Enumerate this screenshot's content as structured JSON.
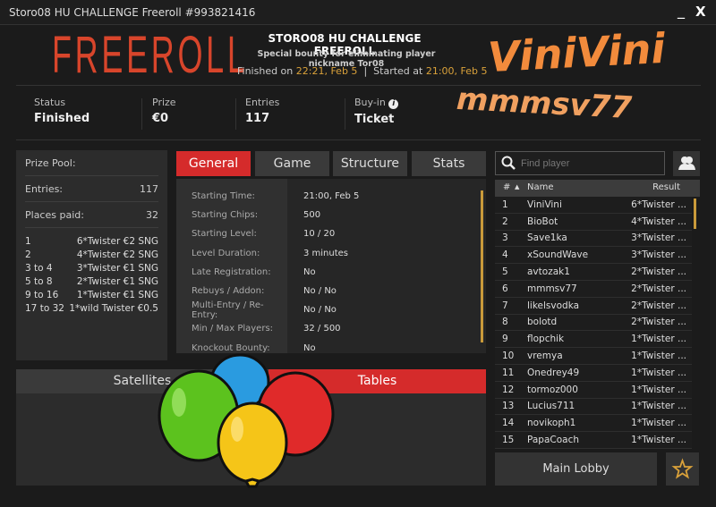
{
  "window": {
    "title": "Storo08 HU CHALLENGE Freeroll #993821416",
    "minimize": "_",
    "close": "X"
  },
  "header": {
    "logo_text": "FREEROLL",
    "title": "STORO08 HU CHALLENGE FREEROLL",
    "subtitle": "Special bounty for eliminating player nickname Tor08",
    "finished_label": "Finished on",
    "finished_time": "22:21, Feb 5",
    "separator": "|",
    "started_label": "Started at",
    "started_time": "21:00, Feb 5"
  },
  "overlay": {
    "text1": "ViniVini",
    "text2": "mmmsv77"
  },
  "stats": [
    {
      "label": "Status",
      "value": "Finished"
    },
    {
      "label": "Prize",
      "value": "€0"
    },
    {
      "label": "Entries",
      "value": "117"
    },
    {
      "label": "Buy-in",
      "value": "Ticket"
    }
  ],
  "prize_pool": {
    "label": "Prize Pool:",
    "entries_label": "Entries:",
    "entries": "117",
    "places_label": "Places paid:",
    "places": "32",
    "payouts": [
      {
        "place": "1",
        "prize": "6*Twister €2 SNG"
      },
      {
        "place": "2",
        "prize": "4*Twister €2 SNG"
      },
      {
        "place": "3  to  4",
        "prize": "3*Twister €1 SNG"
      },
      {
        "place": "5  to  8",
        "prize": "2*Twister €1 SNG"
      },
      {
        "place": "9  to  16",
        "prize": "1*Twister €1 SNG"
      },
      {
        "place": "17  to  32",
        "prize": "1*wild Twister €0.5"
      }
    ]
  },
  "tabs": [
    "General",
    "Game",
    "Structure",
    "Stats"
  ],
  "general": [
    {
      "k": "Starting Time:",
      "v": "21:00, Feb 5"
    },
    {
      "k": "Starting Chips:",
      "v": "500"
    },
    {
      "k": "Starting Level:",
      "v": "10 / 20"
    },
    {
      "k": "Level Duration:",
      "v": "3 minutes"
    },
    {
      "k": "Late Registration:",
      "v": "No"
    },
    {
      "k": "Rebuys / Addon:",
      "v": "No / No"
    },
    {
      "k": "Multi-Entry / Re-Entry:",
      "v": "No / No"
    },
    {
      "k": "Min / Max Players:",
      "v": "32 / 500"
    },
    {
      "k": "Knockout Bounty:",
      "v": "No"
    }
  ],
  "bottom_tabs": [
    "Satellites",
    "Tables"
  ],
  "search": {
    "placeholder": "Find player"
  },
  "players": {
    "headers": {
      "num": "#",
      "sort": "▲",
      "name": "Name",
      "result": "Result"
    },
    "rows": [
      [
        "1",
        "ViniVini",
        "6*Twister ..."
      ],
      [
        "2",
        "BioBot",
        "4*Twister ..."
      ],
      [
        "3",
        "Save1ka",
        "3*Twister ..."
      ],
      [
        "4",
        "xSoundWave",
        "3*Twister ..."
      ],
      [
        "5",
        "avtozak1",
        "2*Twister ..."
      ],
      [
        "6",
        "mmmsv77",
        "2*Twister ..."
      ],
      [
        "7",
        "likelsvodka",
        "2*Twister ..."
      ],
      [
        "8",
        "bolotd",
        "2*Twister ..."
      ],
      [
        "9",
        "flopchik",
        "1*Twister ..."
      ],
      [
        "10",
        "vremya",
        "1*Twister ..."
      ],
      [
        "11",
        "Onedrey49",
        "1*Twister ..."
      ],
      [
        "12",
        "tormoz000",
        "1*Twister ..."
      ],
      [
        "13",
        "Lucius711",
        "1*Twister ..."
      ],
      [
        "14",
        "novikoph1",
        "1*Twister ..."
      ],
      [
        "15",
        "PapaCoach",
        "1*Twister ..."
      ]
    ]
  },
  "main_lobby": "Main Lobby",
  "colors": {
    "accent": "#d52b2b",
    "gold": "#d9a13a",
    "overlay": "#f28b3c"
  }
}
